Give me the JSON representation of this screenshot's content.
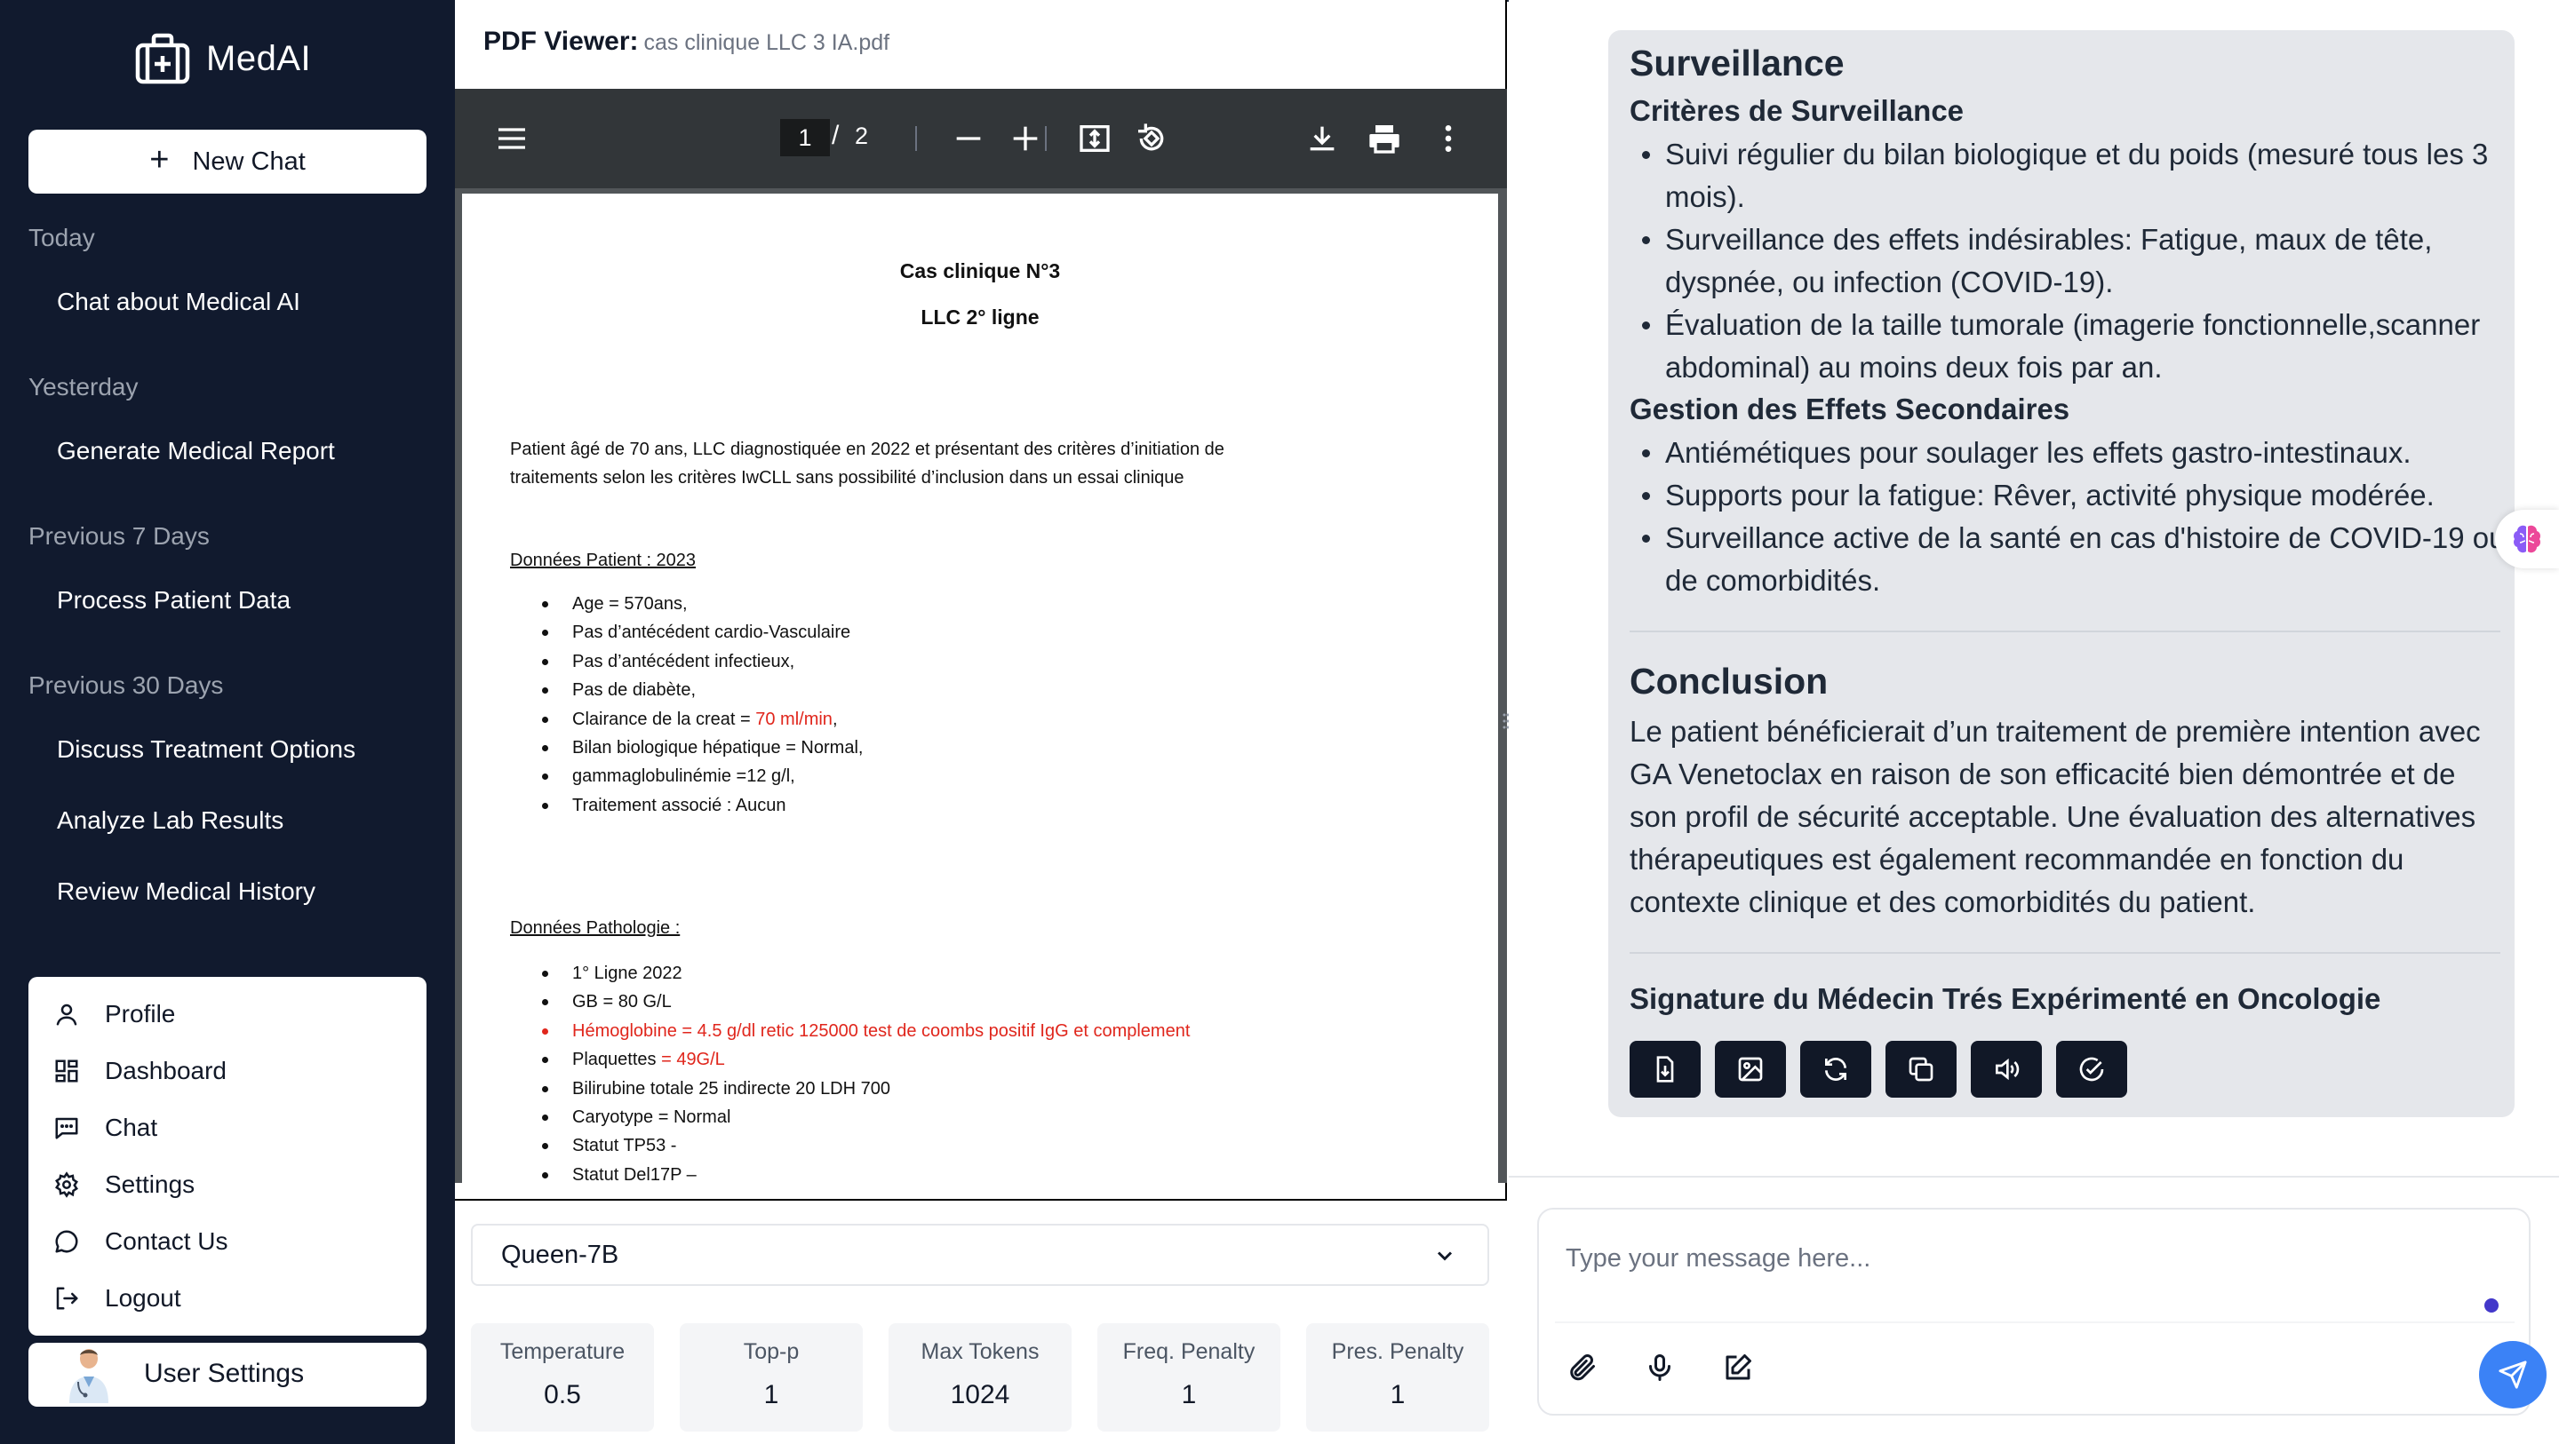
{
  "app": {
    "name": "MedAI"
  },
  "sidebar": {
    "new_chat_label": "New Chat",
    "sections": [
      {
        "title": "Today",
        "items": [
          "Chat about Medical AI"
        ]
      },
      {
        "title": "Yesterday",
        "items": [
          "Generate Medical Report"
        ]
      },
      {
        "title": "Previous 7 Days",
        "items": [
          "Process Patient Data"
        ]
      },
      {
        "title": "Previous 30 Days",
        "items": [
          "Discuss Treatment Options",
          "Analyze Lab Results",
          "Review Medical History"
        ]
      }
    ],
    "menu": [
      {
        "label": "Profile",
        "icon": "user-icon"
      },
      {
        "label": "Dashboard",
        "icon": "dashboard-icon"
      },
      {
        "label": "Chat",
        "icon": "chat-icon"
      },
      {
        "label": "Settings",
        "icon": "gear-icon"
      },
      {
        "label": "Contact Us",
        "icon": "message-circle-icon"
      },
      {
        "label": "Logout",
        "icon": "logout-icon"
      }
    ],
    "user_settings_label": "User Settings"
  },
  "pdf": {
    "header_label": "PDF Viewer:",
    "file_name": "cas clinique LLC 3 IA.pdf",
    "current_page": "1",
    "page_sep": "/",
    "total_pages": "2",
    "doc": {
      "title1": "Cas clinique N°3",
      "title2": "LLC 2° ligne",
      "intro1": "Patient âgé de 70 ans,  LLC diagnostiquée en 2022 et présentant des critères d’initiation de",
      "intro2": "traitements selon les critères IwCLL sans possibilité d’inclusion dans un essai clinique",
      "section1": "Données Patient : 2023",
      "list1": [
        "Age = 570ans,",
        "Pas d’antécédent cardio-Vasculaire",
        "Pas d’antécédent infectieux,",
        "Pas de diabète,",
        "Clairance de la creat = ",
        "Bilan biologique hépatique = Normal,",
        "gammaglobulinémie  =12 g/l,",
        "Traitement associé : Aucun"
      ],
      "clairance_value": "70 ml/min",
      "clairance_suffix": ",",
      "section2": "Données Pathologie :",
      "list2": [
        "1° Ligne 2022",
        "GB = 80 G/L",
        "Hémoglobine = 4.5 g/dl  retic 125000  test de coombs positif IgG et complement",
        "Plaquettes ",
        "Bilirubine totale 25  indirecte  20  LDH 700",
        "Caryotype = Normal",
        "Statut TP53 -",
        "Statut Del17P –"
      ],
      "plaquettes_value": "= 49G/L"
    }
  },
  "model": {
    "selected": "Queen-7B",
    "params": [
      {
        "label": "Temperature",
        "value": "0.5"
      },
      {
        "label": "Top-p",
        "value": "1"
      },
      {
        "label": "Max Tokens",
        "value": "1024"
      },
      {
        "label": "Freq. Penalty",
        "value": "1"
      },
      {
        "label": "Pres. Penalty",
        "value": "1"
      }
    ]
  },
  "answer": {
    "h_surveillance": "Surveillance",
    "h_criteres": "Critères de Surveillance",
    "criteres": [
      "Suivi régulier du bilan biologique et du poids (mesuré tous les 3 mois).",
      "Surveillance des effets indésirables: Fatigue, maux de tête, dyspnée, ou infection (COVID-19).",
      "Évaluation de la taille tumorale (imagerie fonctionnelle,scanner abdominal) au moins deux fois par an."
    ],
    "h_gestion": "Gestion des Effets Secondaires",
    "gestion": [
      "Antiémétiques pour soulager les effets gastro-intestinaux.",
      "Supports pour la fatigue: Rêver, activité physique modérée.",
      "Surveillance active de la santé en cas d'histoire de COVID-19 ou de comorbidités."
    ],
    "h_conclusion": "Conclusion",
    "conclusion": "Le patient bénéficierait d’un traitement de première intention avec GA Venetoclax en raison de son efficacité bien démontrée et de son profil de sécurité acceptable. Une évaluation des alternatives thérapeutiques est également recommandée en fonction du contexte clinique et des comorbidités du patient.",
    "signature": "Signature du Médecin Trés Expérimenté en Oncologie"
  },
  "input": {
    "placeholder": "Type your message here..."
  },
  "colors": {
    "sidebar_bg": "#111a2e",
    "accent_blue": "#3b82f6",
    "pdf_red": "#e0261c"
  }
}
